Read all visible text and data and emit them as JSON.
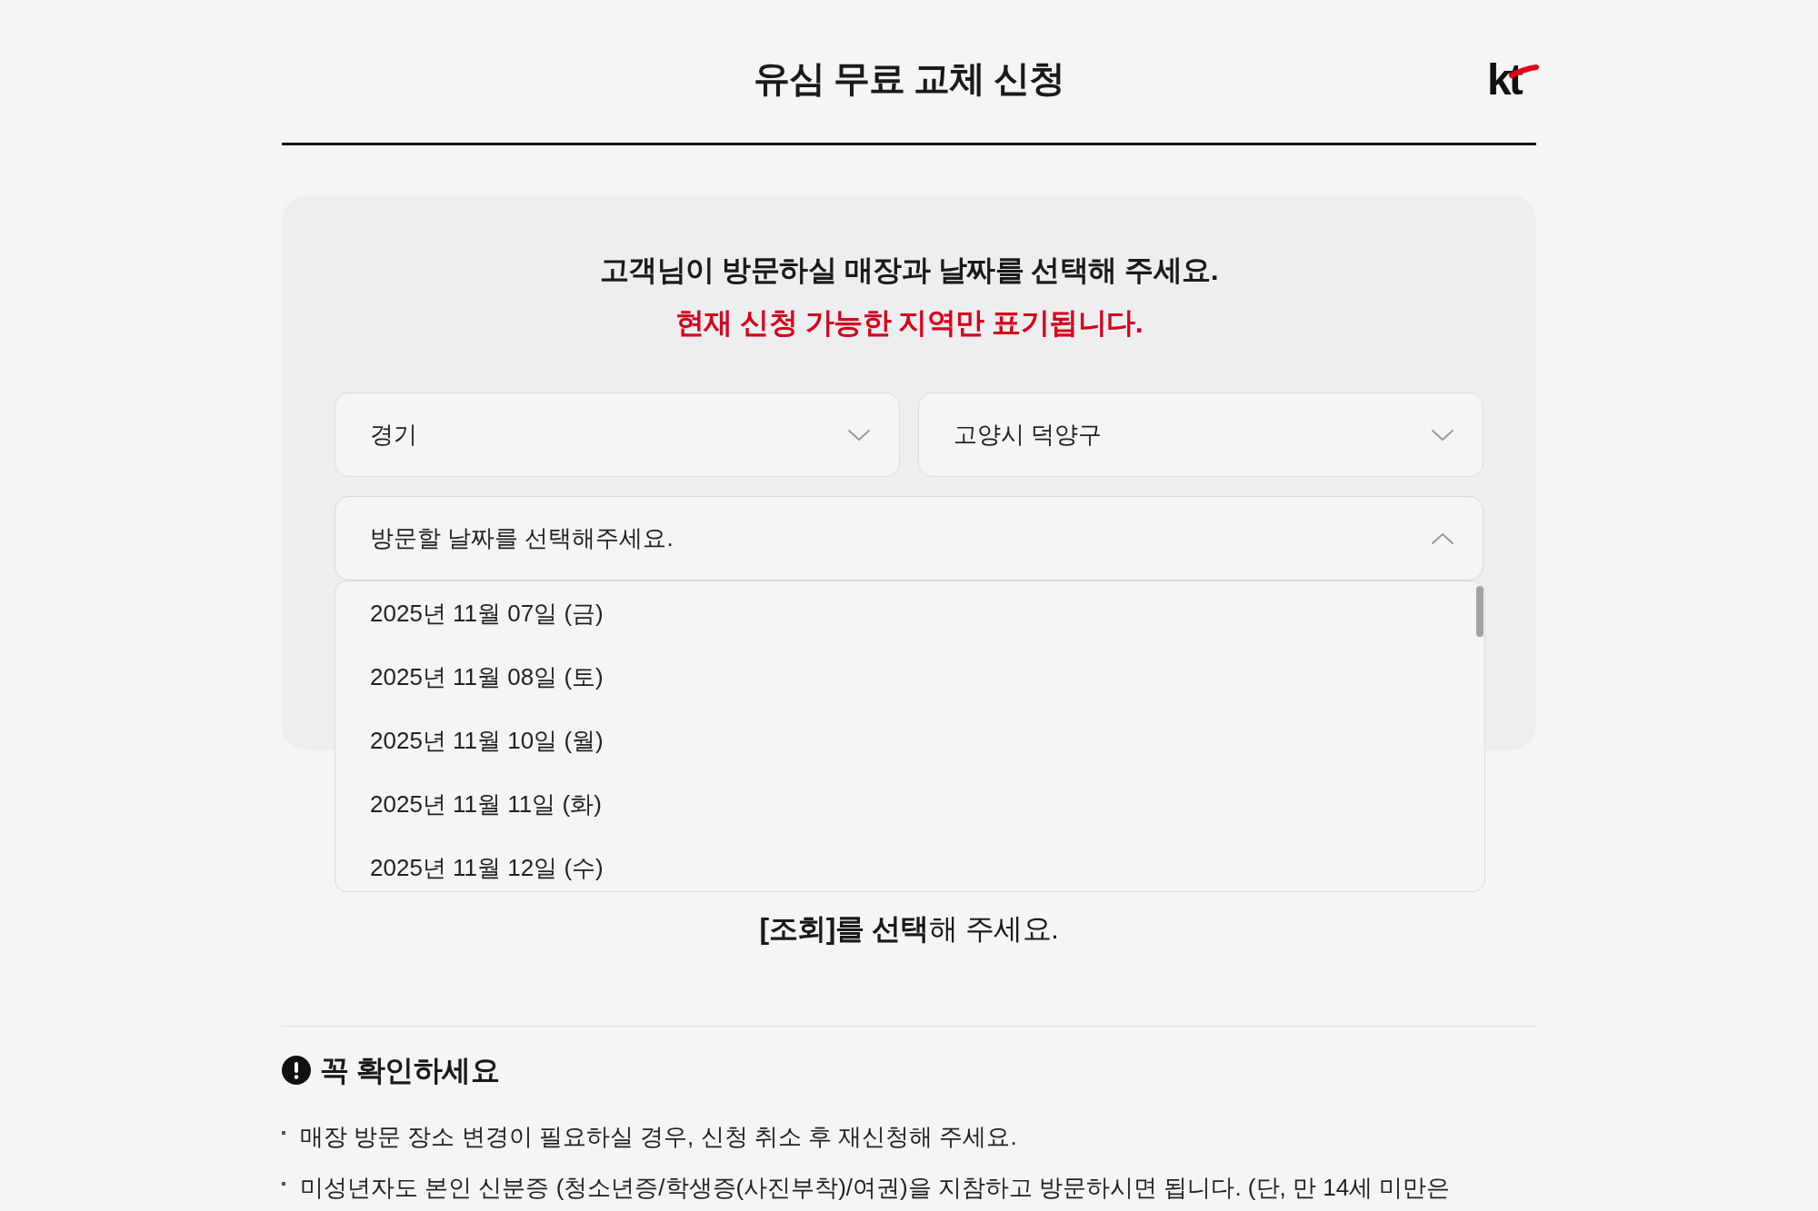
{
  "header": {
    "title": "유심 무료 교체 신청",
    "logo_text": "kt"
  },
  "store_selection": {
    "heading": "고객님이 방문하실 매장과 날짜를 선택해 주세요.",
    "notice": "현재 신청 가능한 지역만 표기됩니다.",
    "region_selects": [
      {
        "value": "경기",
        "expanded": false
      },
      {
        "value": "고양시 덕양구",
        "expanded": false
      }
    ],
    "date_select": {
      "placeholder": "방문할 날짜를 선택해주세요.",
      "expanded": true,
      "options": [
        {
          "label": "2025년 11월 07일 (금)",
          "selected": false
        },
        {
          "label": "2025년 11월 08일 (토)",
          "selected": false
        },
        {
          "label": "2025년 11월 10일 (월)",
          "selected": false
        },
        {
          "label": "2025년 11월 11일 (화)",
          "selected": false
        },
        {
          "label": "2025년 11월 12일 (수)",
          "selected": false
        }
      ]
    }
  },
  "instruction": "**[조회]를 선택**해 주세요.",
  "notice_section": {
    "title": "꼭 확인하세요",
    "items": [
      "매장 방문 장소 변경이 필요하실 경우, 신청 취소 후 재신청해 주세요.",
      "미성년자도 본인 신분증 (청소년증/학생증(사진부착)/여권)을 지참하고 방문하시면 됩니다. (단, 만 14세 미만은"
    ]
  }
}
